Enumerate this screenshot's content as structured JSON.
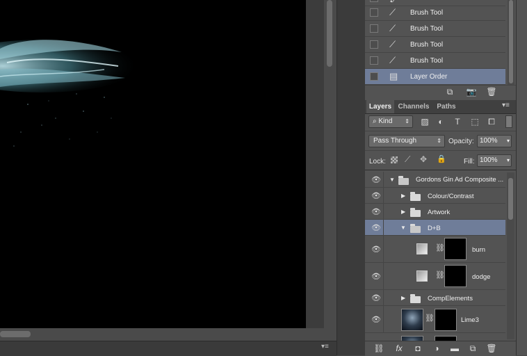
{
  "history": {
    "items": [
      {
        "label": "Brush Tool",
        "icon": "brush-icon"
      },
      {
        "label": "Brush Tool",
        "icon": "brush-icon"
      },
      {
        "label": "Brush Tool",
        "icon": "brush-icon"
      },
      {
        "label": "Brush Tool",
        "icon": "brush-icon"
      },
      {
        "label": "Layer Order",
        "icon": "document-icon",
        "selected": true
      }
    ]
  },
  "tabs": [
    "Layers",
    "Channels",
    "Paths"
  ],
  "filter": {
    "kind_label": "Kind"
  },
  "blend": {
    "mode": "Pass Through",
    "opacity_label": "Opacity:",
    "opacity_value": "100%"
  },
  "lock": {
    "lock_label": "Lock:",
    "fill_label": "Fill:",
    "fill_value": "100%"
  },
  "layers": [
    {
      "name": "Gordons Gin Ad Composite ..."
    },
    {
      "name": "Colour/Contrast"
    },
    {
      "name": "Artwork"
    },
    {
      "name": "D+B"
    },
    {
      "name": "burn"
    },
    {
      "name": "dodge"
    },
    {
      "name": "CompElements"
    },
    {
      "name": "Lime3"
    }
  ],
  "colors": {
    "selection": "#6f7d99",
    "panel": "#535353",
    "canvas": "#000000"
  }
}
